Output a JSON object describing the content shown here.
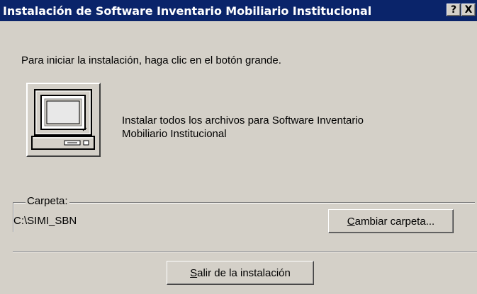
{
  "window": {
    "title": "Instalación de Software Inventario Mobiliario Institucional",
    "help_label": "?",
    "close_label": "X"
  },
  "main": {
    "intro_text": "Para iniciar la instalación, haga clic en el botón grande.",
    "install_button_icon": "computer-icon",
    "install_description_line1": "Instalar todos los archivos para Software Inventario",
    "install_description_line2": "Mobiliario Institucional"
  },
  "folder": {
    "group_label": "Carpeta:",
    "path": "C:\\SIMI_SBN",
    "change_button_access_key": "C",
    "change_button_rest": "ambiar carpeta..."
  },
  "footer": {
    "exit_button_access_key": "S",
    "exit_button_rest": "alir de la instalación"
  },
  "colors": {
    "titlebar": "#0a246a",
    "face": "#d4d0c8"
  }
}
